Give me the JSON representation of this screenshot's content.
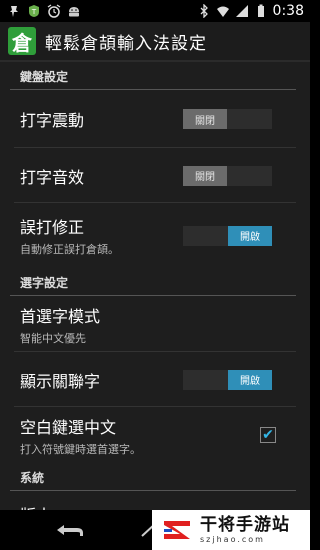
{
  "status_bar": {
    "time": "0:38",
    "left_icons": [
      "pin-icon",
      "app-notification-icon",
      "alarm-icon",
      "android-icon"
    ],
    "right_icons": [
      "bluetooth-icon",
      "wifi-icon",
      "signal-icon",
      "battery-icon"
    ]
  },
  "action_bar": {
    "app_icon_char": "倉",
    "title": "輕鬆倉頡輸入法設定"
  },
  "sections": {
    "keyboard": "鍵盤設定",
    "select": "選字設定",
    "system": "系統"
  },
  "prefs": {
    "vibrate": {
      "title": "打字震動",
      "state": "關閉",
      "checked": false
    },
    "sound": {
      "title": "打字音效",
      "state": "關閉",
      "checked": false
    },
    "autocorrect": {
      "title": "誤打修正",
      "summary": "自動修正誤打倉頡。",
      "state": "開啟",
      "checked": true
    },
    "first_mode": {
      "title": "首選字模式",
      "summary": "智能中文優先"
    },
    "related": {
      "title": "顯示關聯字",
      "state": "開啟",
      "checked": true
    },
    "space_select": {
      "title": "空白鍵選中文",
      "summary": "打入符號鍵時選首選字。",
      "check_mark": "✔",
      "checked": true
    },
    "version": {
      "title": "版本"
    }
  },
  "watermark": {
    "name": "干将手游站",
    "domain": "szjhao.com"
  },
  "colors": {
    "accent": "#33b5e5",
    "toggle_on": "#2f8fb8",
    "app_icon_bg": "#2f9e3a",
    "background": "#1e1e1e"
  }
}
